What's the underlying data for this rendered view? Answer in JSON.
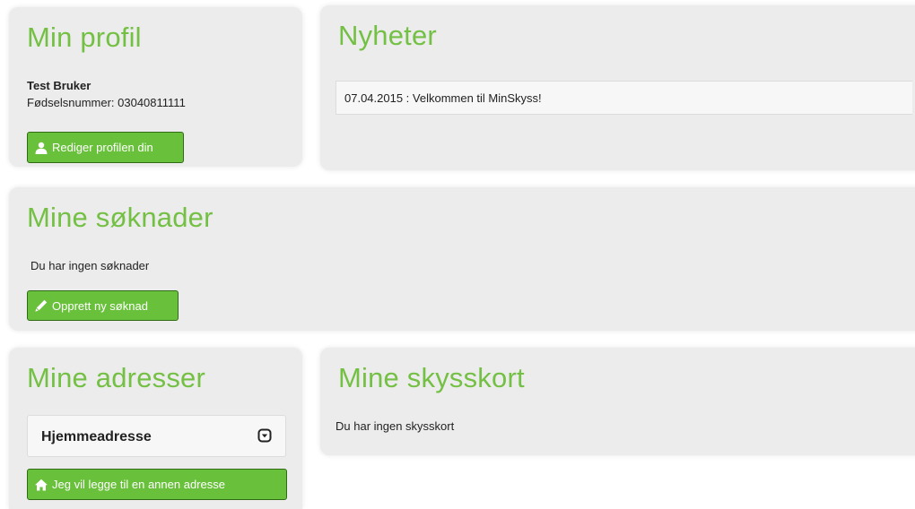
{
  "profile": {
    "title": "Min profil",
    "name": "Test Bruker",
    "ssn": "Fødselsnummer: 03040811111",
    "edit_button": "Rediger profilen din"
  },
  "news": {
    "title": "Nyheter",
    "items": [
      {
        "text": "07.04.2015 : Velkommen til MinSkyss!"
      }
    ]
  },
  "applications": {
    "title": "Mine søknader",
    "empty_text": "Du har ingen søknader",
    "new_button": "Opprett ny søknad"
  },
  "addresses": {
    "title": "Mine adresser",
    "items": [
      {
        "label": "Hjemmeadresse"
      }
    ],
    "add_button": "Jeg vil legge til en annen adresse"
  },
  "travelcards": {
    "title": "Mine skysskort",
    "empty_text": "Du har ingen skysskort"
  },
  "colors": {
    "heading": "#74c044",
    "button": "#69c13b",
    "panel": "#ececec"
  },
  "icons": {
    "edit_profile": "user-icon",
    "new_application": "pencil-icon",
    "add_address": "home-icon",
    "expand_address": "chevron-down-icon"
  }
}
